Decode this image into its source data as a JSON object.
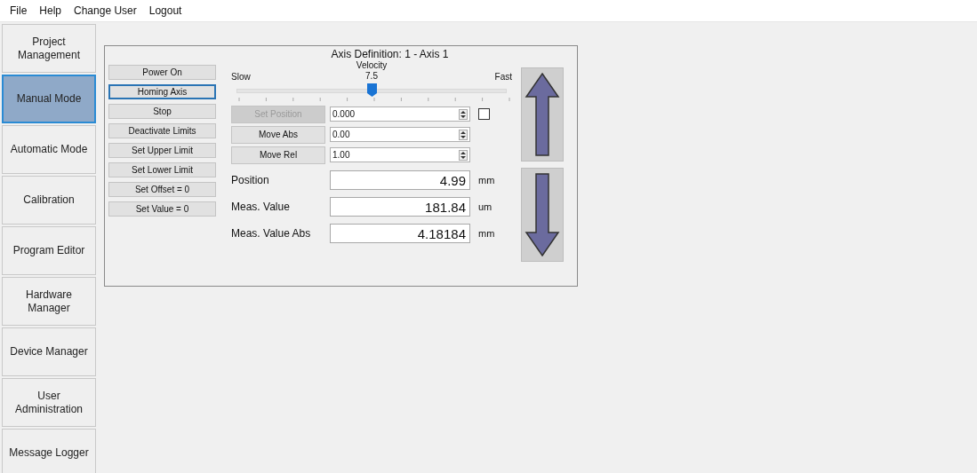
{
  "menu": [
    "File",
    "Help",
    "Change User",
    "Logout"
  ],
  "sidebar": {
    "items": [
      {
        "label": "Project Management",
        "selected": false
      },
      {
        "label": "Manual Mode",
        "selected": true
      },
      {
        "label": "Automatic Mode",
        "selected": false
      },
      {
        "label": "Calibration",
        "selected": false
      },
      {
        "label": "Program Editor",
        "selected": false
      },
      {
        "label": "Hardware Manager",
        "selected": false
      },
      {
        "label": "Device Manager",
        "selected": false
      },
      {
        "label": "User Administration",
        "selected": false
      },
      {
        "label": "Message Logger",
        "selected": false
      }
    ]
  },
  "panel": {
    "title": "Axis Definition: 1 - Axis 1",
    "actions": [
      {
        "label": "Power On",
        "focused": false
      },
      {
        "label": "Homing Axis",
        "focused": true
      },
      {
        "label": "Stop",
        "focused": false
      },
      {
        "label": "Deactivate Limits",
        "focused": false
      },
      {
        "label": "Set Upper Limit",
        "focused": false
      },
      {
        "label": "Set Lower Limit",
        "focused": false
      },
      {
        "label": "Set Offset = 0",
        "focused": false
      },
      {
        "label": "Set Value = 0",
        "focused": false
      }
    ],
    "velocity": {
      "label": "Velocity",
      "value": "7.5",
      "min_label": "Slow",
      "max_label": "Fast",
      "level": 0.5
    },
    "moves": [
      {
        "label": "Set Position",
        "disabled": true,
        "value": "0.000",
        "checked": false
      },
      {
        "label": "Move Abs",
        "disabled": false,
        "value": "0.00"
      },
      {
        "label": "Move Rel",
        "disabled": false,
        "value": "1.00"
      }
    ],
    "readouts": [
      {
        "label": "Position",
        "value": "4.99",
        "unit": "mm"
      },
      {
        "label": "Meas. Value",
        "value": "181.84",
        "unit": "um"
      },
      {
        "label": "Meas. Value Abs",
        "value": "4.18184",
        "unit": "mm"
      }
    ],
    "jog": [
      {
        "kind": "up"
      },
      {
        "kind": "down"
      }
    ]
  }
}
